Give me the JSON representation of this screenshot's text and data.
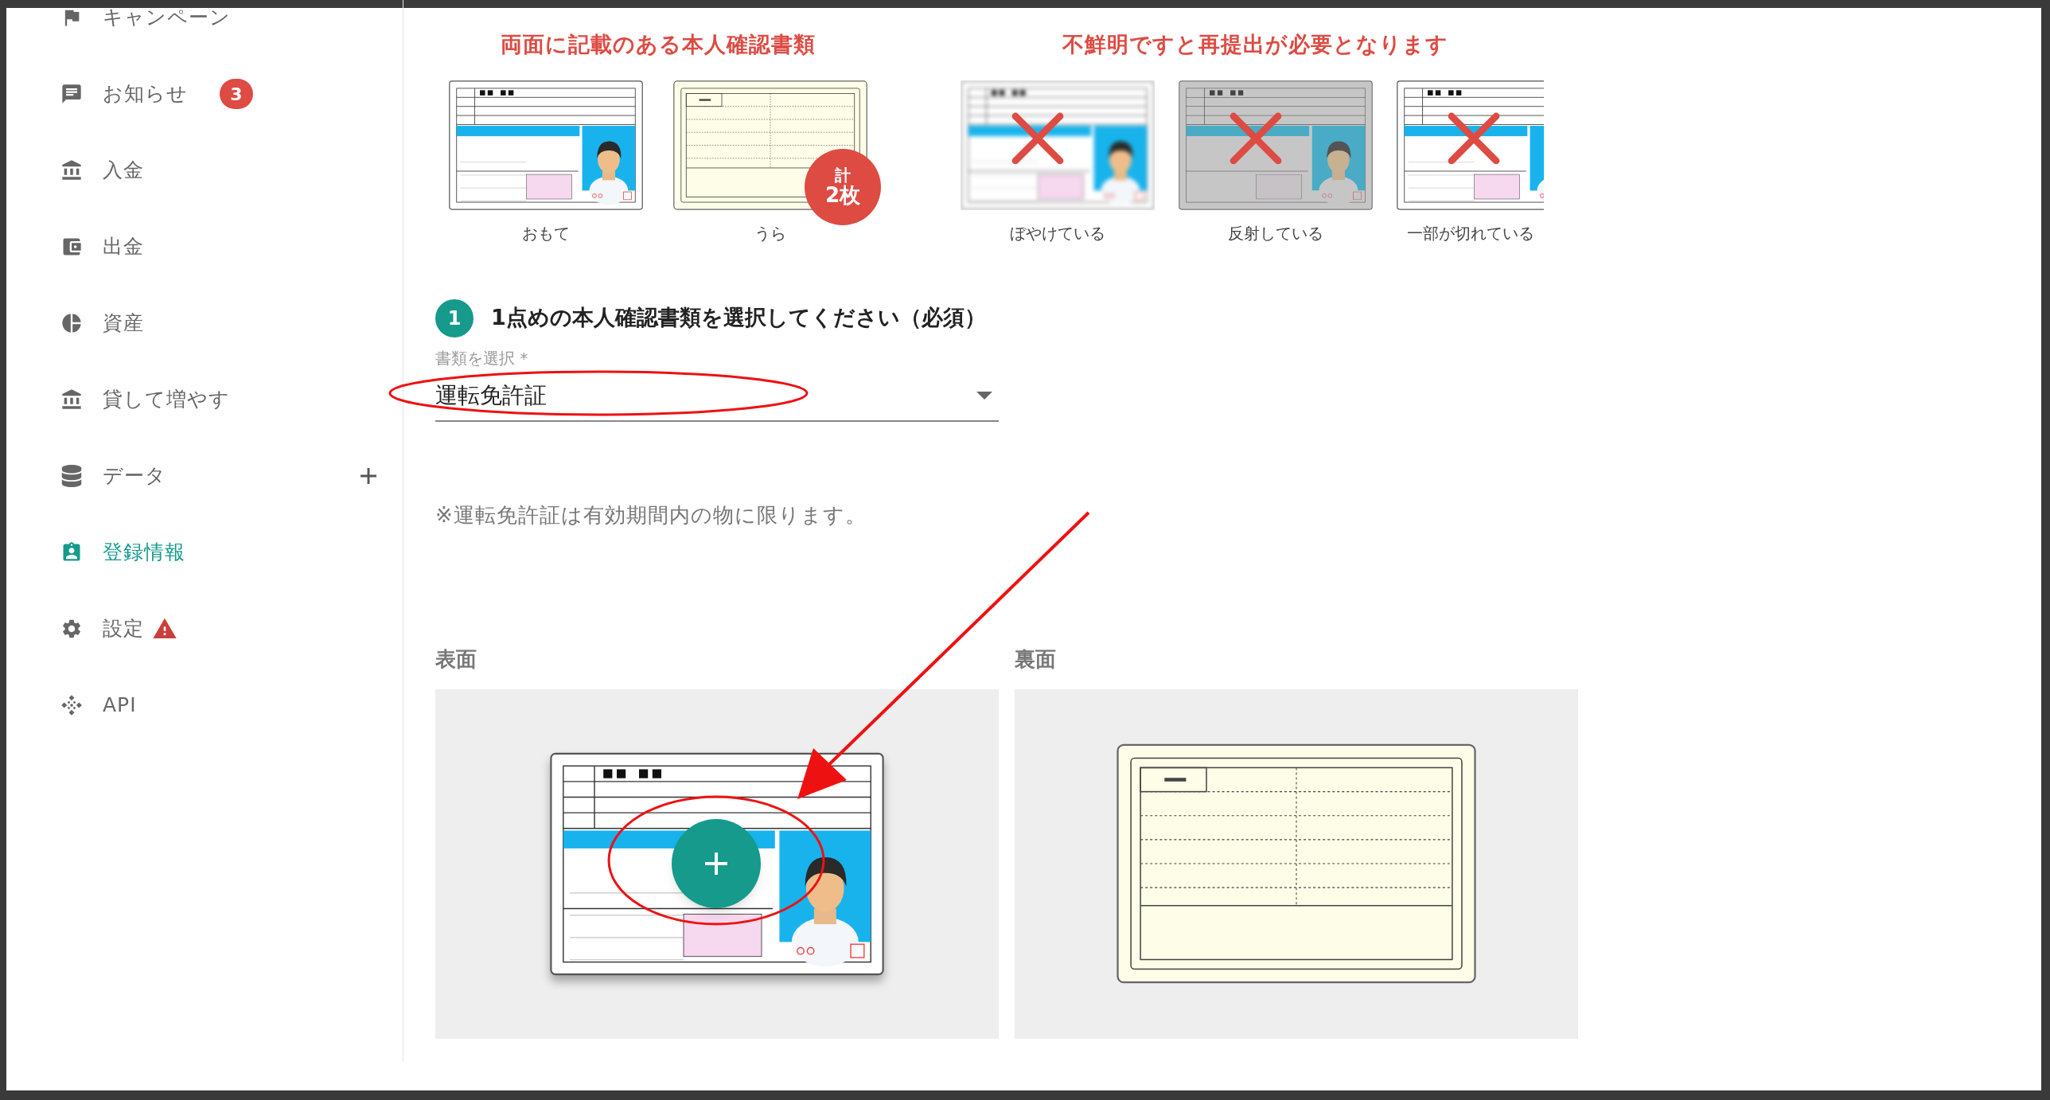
{
  "sidebar": {
    "items": [
      {
        "label": "キャンペーン",
        "selected": false
      },
      {
        "label": "お知らせ",
        "selected": false,
        "badge": "3"
      },
      {
        "label": "入金",
        "selected": false
      },
      {
        "label": "出金",
        "selected": false
      },
      {
        "label": "資産",
        "selected": false
      },
      {
        "label": "貸して増やす",
        "selected": false
      },
      {
        "label": "データ",
        "selected": false,
        "expandable": true
      },
      {
        "label": "登録情報",
        "selected": true
      },
      {
        "label": "設定",
        "selected": false,
        "warning": true
      },
      {
        "label": "API",
        "selected": false
      }
    ]
  },
  "examples": {
    "valid": {
      "heading": "両面に記載のある本人確認書類",
      "badge": [
        "計",
        "2枚"
      ],
      "cards": [
        {
          "kind": "front",
          "label": "おもて"
        },
        {
          "kind": "back",
          "label": "うら"
        }
      ]
    },
    "invalid": {
      "heading": "不鮮明ですと再提出が必要となります",
      "cards": [
        {
          "kind": "blurred",
          "label": "ぼやけている"
        },
        {
          "kind": "glare",
          "label": "反射している"
        },
        {
          "kind": "cropped",
          "label": "一部が切れている"
        }
      ]
    }
  },
  "step": {
    "number": "1",
    "title": "1点めの本人確認書類を選択してください（必須）"
  },
  "document_select": {
    "label": "書類を選択 *",
    "value": "運転免許証"
  },
  "note": "※運転免許証は有効期間内の物に限ります。",
  "uploads": [
    {
      "label": "表面",
      "kind": "front",
      "has_add_button": true
    },
    {
      "label": "裏面",
      "kind": "back",
      "has_add_button": false
    }
  ]
}
